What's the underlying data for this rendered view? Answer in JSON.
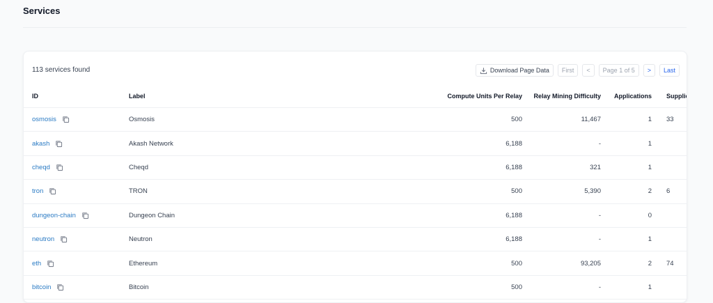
{
  "page": {
    "title": "Services"
  },
  "summary": {
    "found_text": "113 services found"
  },
  "controls": {
    "download_label": "Download Page Data",
    "first_label": "First",
    "prev_label": "<",
    "page_label": "Page 1 of 5",
    "next_label": ">",
    "last_label": "Last"
  },
  "table": {
    "columns": {
      "id": "ID",
      "label": "Label",
      "compute_units": "Compute Units Per Relay",
      "relay_mining_difficulty": "Relay Mining Difficulty",
      "applications": "Applications",
      "suppliers": "Supplie"
    },
    "rows": [
      {
        "id": "osmosis",
        "label": "Osmosis",
        "compute_units": "500",
        "relay_mining_difficulty": "11,467",
        "applications": "1",
        "suppliers": "33"
      },
      {
        "id": "akash",
        "label": "Akash Network",
        "compute_units": "6,188",
        "relay_mining_difficulty": "-",
        "applications": "1",
        "suppliers": ""
      },
      {
        "id": "cheqd",
        "label": "Cheqd",
        "compute_units": "6,188",
        "relay_mining_difficulty": "321",
        "applications": "1",
        "suppliers": ""
      },
      {
        "id": "tron",
        "label": "TRON",
        "compute_units": "500",
        "relay_mining_difficulty": "5,390",
        "applications": "2",
        "suppliers": "6"
      },
      {
        "id": "dungeon-chain",
        "label": "Dungeon Chain",
        "compute_units": "6,188",
        "relay_mining_difficulty": "-",
        "applications": "0",
        "suppliers": ""
      },
      {
        "id": "neutron",
        "label": "Neutron",
        "compute_units": "6,188",
        "relay_mining_difficulty": "-",
        "applications": "1",
        "suppliers": ""
      },
      {
        "id": "eth",
        "label": "Ethereum",
        "compute_units": "500",
        "relay_mining_difficulty": "93,205",
        "applications": "2",
        "suppliers": "74"
      },
      {
        "id": "bitcoin",
        "label": "Bitcoin",
        "compute_units": "500",
        "relay_mining_difficulty": "-",
        "applications": "1",
        "suppliers": ""
      }
    ]
  },
  "colors": {
    "link": "#2b7bc4",
    "accent": "#2563eb"
  },
  "icons": {
    "copy": "copy-icon",
    "download": "download-icon"
  }
}
